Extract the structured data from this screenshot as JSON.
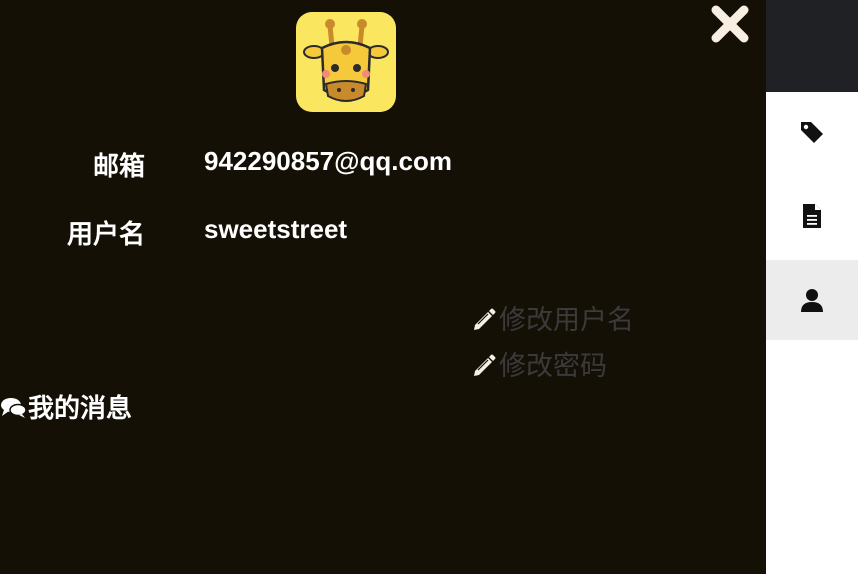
{
  "profile": {
    "avatar_icon": "giraffe-avatar-icon",
    "email_label": "邮箱",
    "email_value": "942290857@qq.com",
    "username_label": "用户名",
    "username_value": "sweetstreet"
  },
  "actions": {
    "edit_username": "修改用户名",
    "edit_password": "修改密码"
  },
  "messages": {
    "label": "我的消息"
  },
  "sidebar": {
    "items": [
      {
        "icon": "tag-icon"
      },
      {
        "icon": "document-icon"
      },
      {
        "icon": "user-icon",
        "active": true
      }
    ]
  },
  "colors": {
    "panel_bg": "#141006",
    "avatar_bg": "#fbe65f",
    "action_text": "#3a3a3a",
    "sidebar_top": "#1f2125",
    "sidebar_active": "#ececec"
  }
}
